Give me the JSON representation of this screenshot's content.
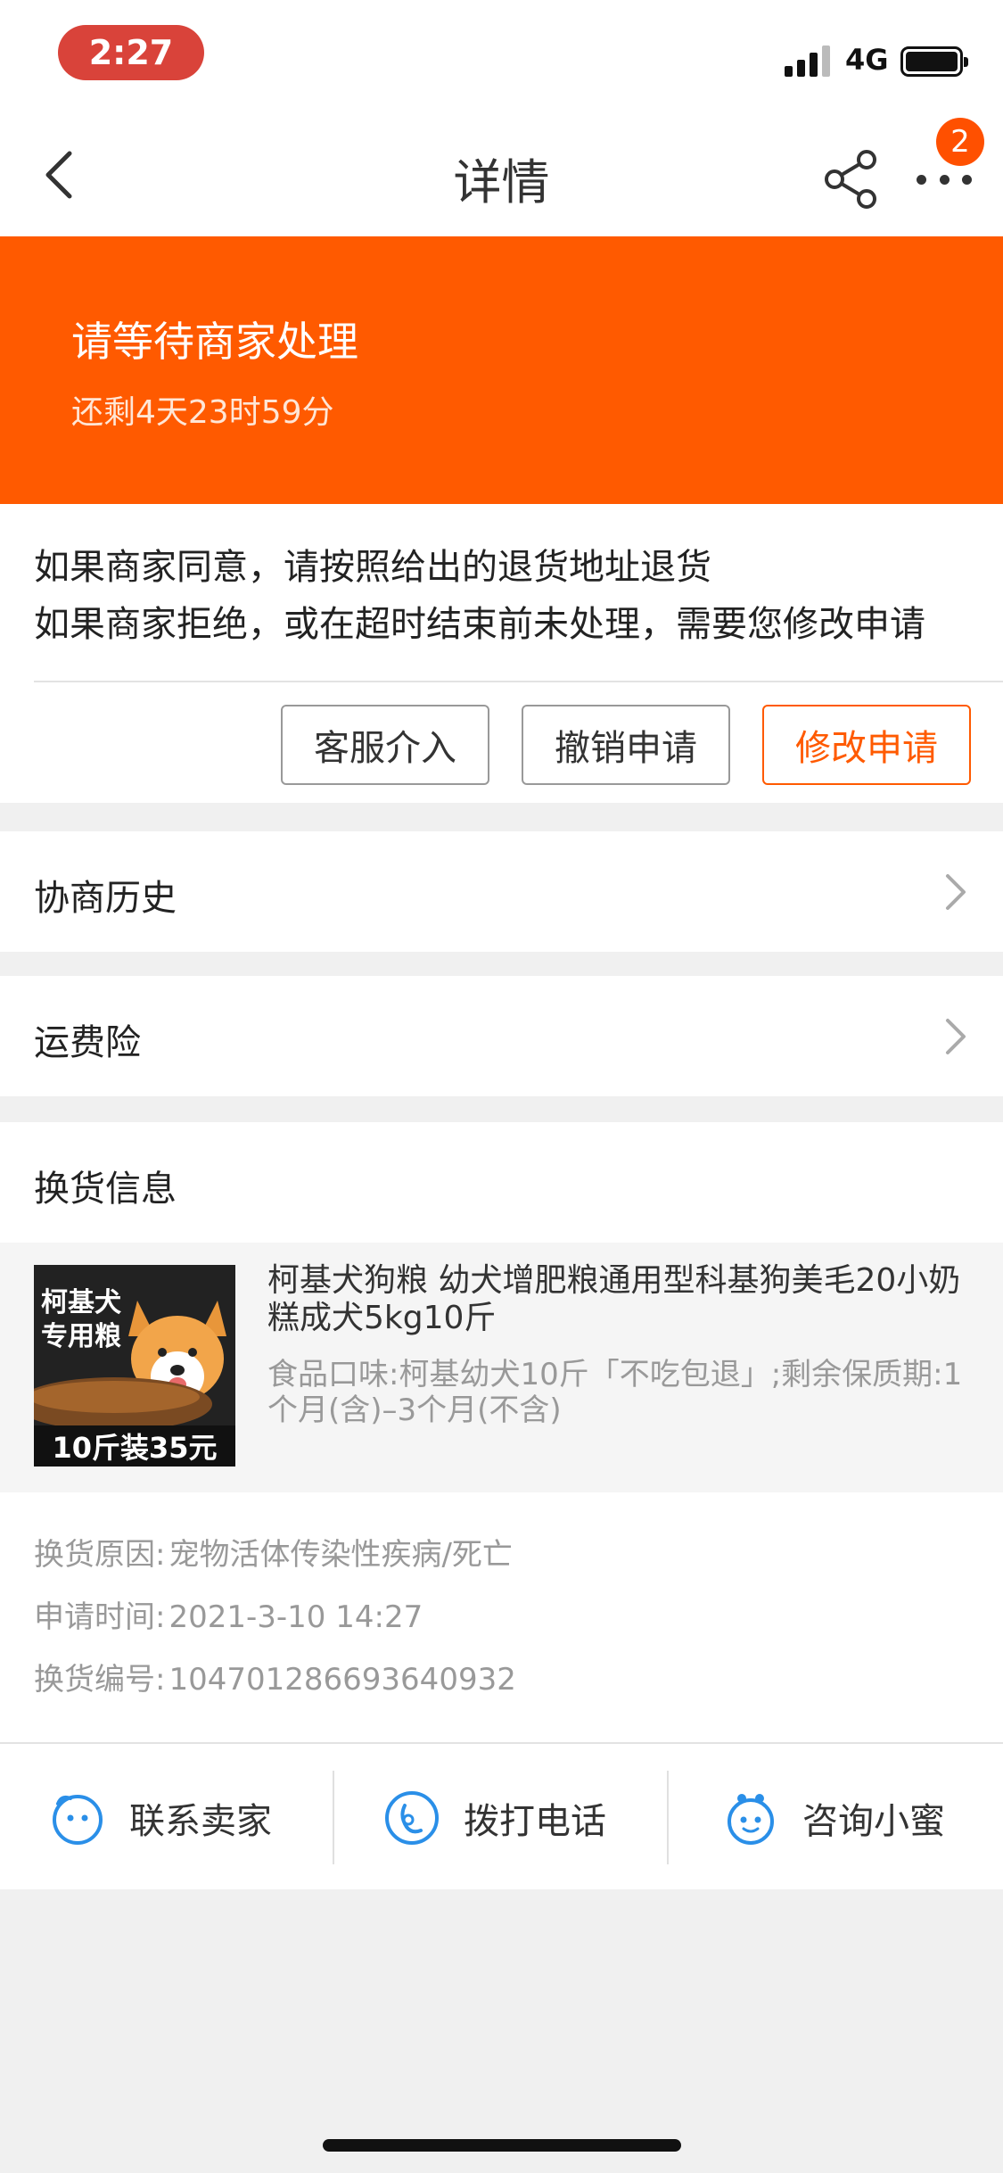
{
  "status_bar": {
    "time": "2:27",
    "network": "4G"
  },
  "nav": {
    "title": "详情",
    "badge_count": "2"
  },
  "banner": {
    "title": "请等待商家处理",
    "countdown": "还剩4天23时59分",
    "color": "#ff5a00"
  },
  "notice": {
    "line1": "如果商家同意，请按照给出的退货地址退货",
    "line2": "如果商家拒绝，或在超时结束前未处理，需要您修改申请"
  },
  "actions": {
    "service": "客服介入",
    "cancel": "撤销申请",
    "modify": "修改申请"
  },
  "rows": {
    "history": "协商历史",
    "freight": "运费险"
  },
  "exchange": {
    "heading": "换货信息",
    "product": {
      "thumb_tag_line1": "柯基犬",
      "thumb_tag_line2": "专用粮",
      "thumb_price": "10斤装35元",
      "title": "柯基犬狗粮 幼犬增肥粮通用型科基狗美毛20小奶糕成犬5kg10斤",
      "spec": "食品口味:柯基幼犬10斤「不吃包退」;剩余保质期:1个月(含)–3个月(不含)"
    },
    "meta": [
      {
        "key": "换货原因:",
        "value": "宠物活体传染性疾病/死亡"
      },
      {
        "key": "申请时间:",
        "value": "2021-3-10 14:27"
      },
      {
        "key": "换货编号:",
        "value": "104701286693640932"
      }
    ]
  },
  "bottom_bar": {
    "contact": "联系卖家",
    "call": "拨打电话",
    "consult": "咨询小蜜"
  },
  "icons": {
    "back": "back-arrow-icon",
    "share": "share-icon",
    "more": "more-dots-icon",
    "chevron": "chevron-right-icon",
    "contact": "seller-chat-icon",
    "call": "phone-icon",
    "consult": "assistant-icon"
  },
  "accent_color": "#ff5a00"
}
